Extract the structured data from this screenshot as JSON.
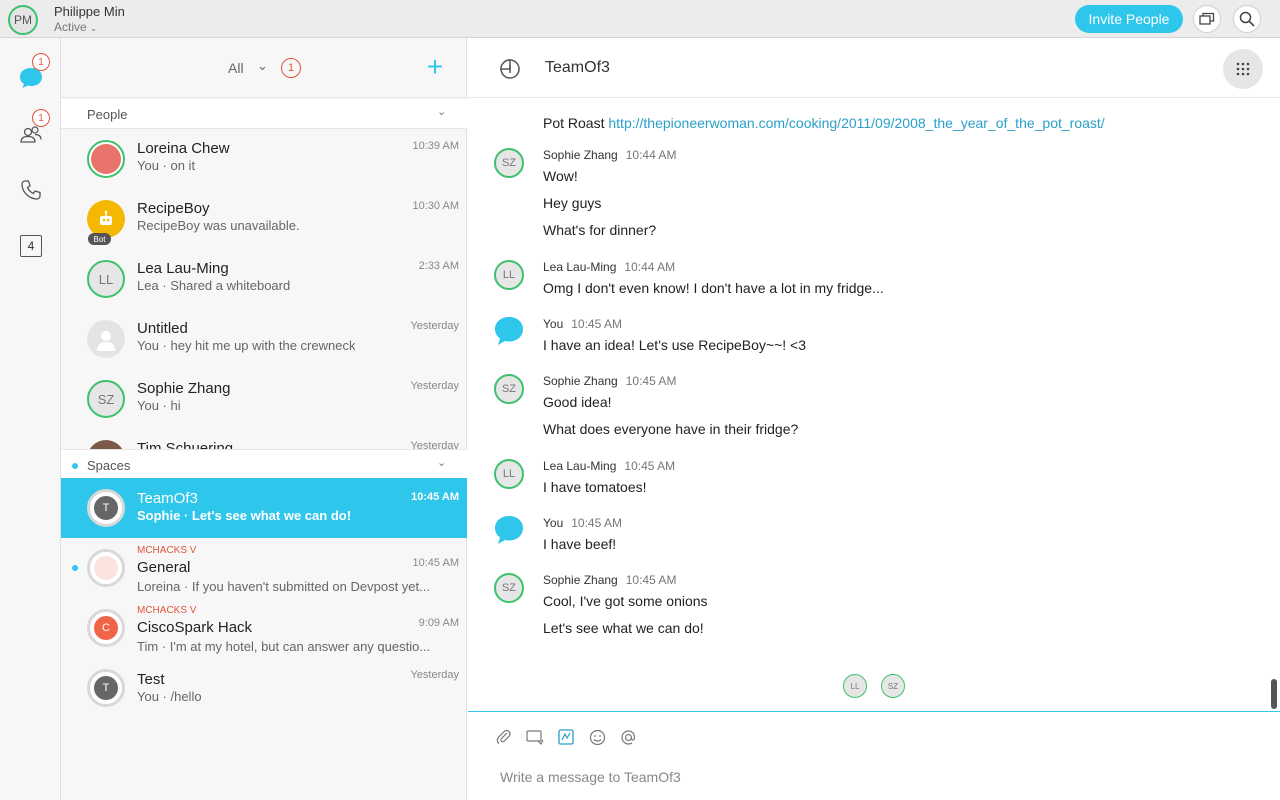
{
  "titlebar": {
    "user_initials": "PM",
    "user_name": "Philippe Min",
    "user_status": "Active",
    "invite_label": "Invite People"
  },
  "rail": {
    "messages_badge": "1",
    "teams_badge": "1",
    "calendar_day": "4"
  },
  "list": {
    "filter": "All",
    "filter_badge": "1",
    "people_section": "People",
    "spaces_section": "Spaces",
    "people": [
      {
        "name": "Loreina Chew",
        "sub": "You · on it",
        "time": "10:39 AM",
        "initials": ""
      },
      {
        "name": "RecipeBoy",
        "sub": "RecipeBoy was unavailable.",
        "time": "10:30 AM",
        "initials": "",
        "tag": "Bot"
      },
      {
        "name": "Lea Lau-Ming",
        "sub": "Lea · Shared a whiteboard",
        "time": "2:33 AM",
        "initials": "LL"
      },
      {
        "name": "Untitled",
        "sub": "You · hey hit me up with the crewneck",
        "time": "Yesterday",
        "initials": ""
      },
      {
        "name": "Sophie Zhang",
        "sub": "You · hi",
        "time": "Yesterday",
        "initials": "SZ"
      },
      {
        "name": "Tim Schuering",
        "sub": "",
        "time": "Yesterday",
        "initials": ""
      }
    ],
    "spaces": [
      {
        "name": "TeamOf3",
        "sub": "Sophie · Let's see what we can do!",
        "time": "10:45 AM",
        "initials": "T",
        "tag": ""
      },
      {
        "name": "General",
        "sub": "Loreina · If you haven't submitted on Devpost yet...",
        "time": "10:45 AM",
        "initials": "",
        "tag": "MCHACKS V"
      },
      {
        "name": "CiscoSpark Hack",
        "sub": "Tim · I'm at my hotel, but can answer any questio...",
        "time": "9:09 AM",
        "initials": "C",
        "tag": "MCHACKS V"
      },
      {
        "name": "Test",
        "sub": "You · /hello",
        "time": "Yesterday",
        "initials": "T",
        "tag": ""
      }
    ]
  },
  "conversation": {
    "title": "TeamOf3",
    "link_prefix": "Pot Roast",
    "link_url": "http://thepioneerwoman.com/cooking/2011/09/2008_the_year_of_the_pot_roast/",
    "messages": [
      {
        "initials": "SZ",
        "sender": "Sophie Zhang",
        "time": "10:44 AM",
        "lines": [
          "Wow!",
          "Hey guys",
          "What's for dinner?"
        ]
      },
      {
        "initials": "LL",
        "sender": "Lea Lau-Ming",
        "time": "10:44 AM",
        "lines": [
          "Omg I don't even know! I don't have a lot in my fridge..."
        ]
      },
      {
        "initials": "",
        "sender": "You",
        "time": "10:45 AM",
        "lines": [
          "I have an idea! Let's use RecipeBoy~~! <3"
        ]
      },
      {
        "initials": "SZ",
        "sender": "Sophie Zhang",
        "time": "10:45 AM",
        "lines": [
          "Good idea!",
          "What does everyone have in their fridge?"
        ]
      },
      {
        "initials": "LL",
        "sender": "Lea Lau-Ming",
        "time": "10:45 AM",
        "lines": [
          "I have tomatoes!"
        ]
      },
      {
        "initials": "",
        "sender": "You",
        "time": "10:45 AM",
        "lines": [
          "I have beef!"
        ]
      },
      {
        "initials": "SZ",
        "sender": "Sophie Zhang",
        "time": "10:45 AM",
        "lines": [
          "Cool, I've got some onions",
          "Let's see what we can do!"
        ]
      }
    ],
    "read_receipts": [
      "LL",
      "SZ"
    ],
    "composer_placeholder": "Write a message to TeamOf3"
  },
  "colors": {
    "accent": "#2fc6ec",
    "online": "#3cc26b",
    "badge": "#e0553a"
  }
}
